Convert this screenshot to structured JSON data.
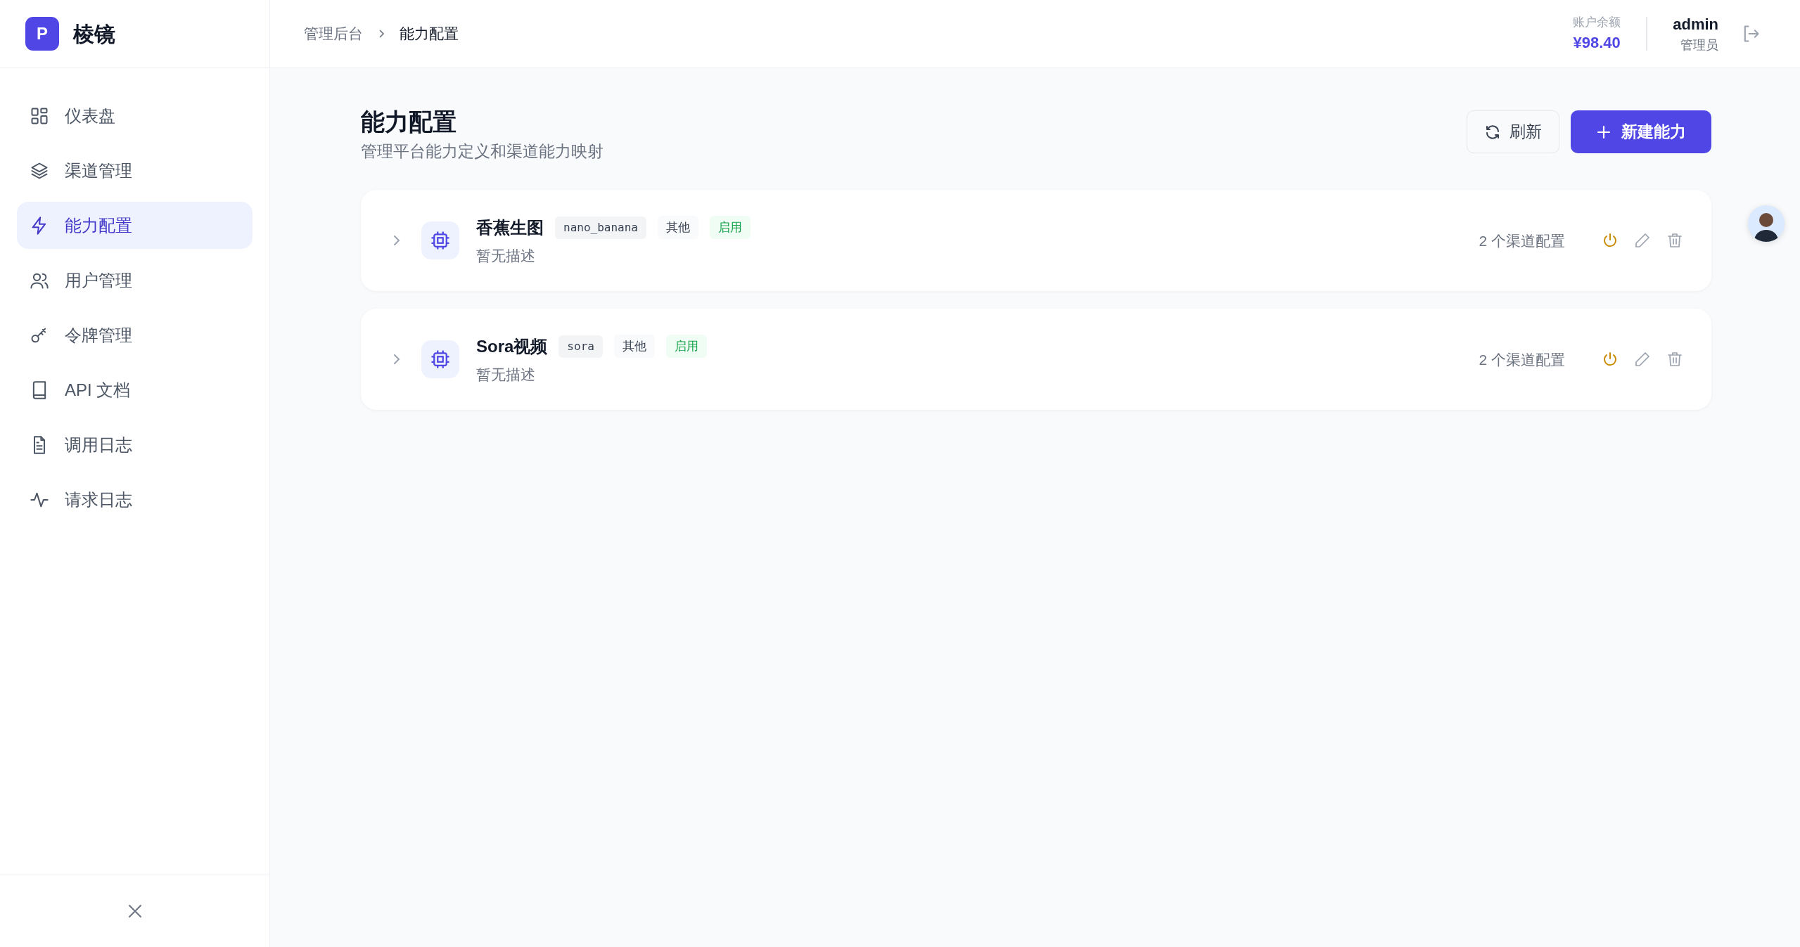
{
  "brand": {
    "logo_letter": "P",
    "name": "棱镜"
  },
  "sidebar": {
    "items": [
      {
        "label": "仪表盘",
        "selected": false
      },
      {
        "label": "渠道管理",
        "selected": false
      },
      {
        "label": "能力配置",
        "selected": true
      },
      {
        "label": "用户管理",
        "selected": false
      },
      {
        "label": "令牌管理",
        "selected": false
      },
      {
        "label": "API 文档",
        "selected": false
      },
      {
        "label": "调用日志",
        "selected": false
      },
      {
        "label": "请求日志",
        "selected": false
      }
    ]
  },
  "breadcrumb": [
    "管理后台",
    "能力配置"
  ],
  "account": {
    "balance_label": "账户余额",
    "balance": "¥98.40",
    "username": "admin",
    "role": "管理员"
  },
  "page": {
    "title": "能力配置",
    "subtitle": "管理平台能力定义和渠道能力映射",
    "buttons": [
      "刷新",
      "新建能力"
    ]
  },
  "capabilities": [
    {
      "name": "香蕉生图",
      "code": "nano_banana",
      "category": "其他",
      "status": "启用",
      "enabled": true,
      "expanded": false,
      "description": "暂无描述",
      "channel_count": "2 个渠道配置"
    },
    {
      "name": "Sora视频",
      "code": "sora",
      "category": "其他",
      "status": "启用",
      "enabled": true,
      "expanded": false,
      "description": "暂无描述",
      "channel_count": "2 个渠道配置"
    }
  ]
}
